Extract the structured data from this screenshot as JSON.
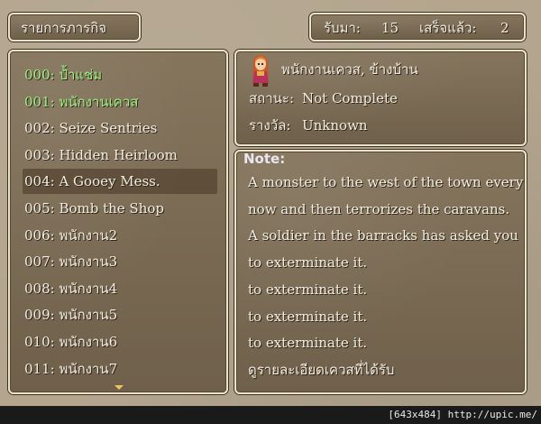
{
  "header": {
    "menu_title": "รายการภารกิจ",
    "received_label": "รับมา:",
    "received_count": "15",
    "completed_label": "เสร็จแล้ว:",
    "completed_count": "2"
  },
  "quest_list": {
    "items": [
      {
        "label": "000: ป้ำแช่ม",
        "completed": true
      },
      {
        "label": "001: พนักงานเควส",
        "completed": true
      },
      {
        "label": "002: Seize Sentries",
        "completed": false
      },
      {
        "label": "003: Hidden Heirloom",
        "completed": false
      },
      {
        "label": "004: A Gooey Mess.",
        "completed": false
      },
      {
        "label": "005: Bomb the Shop",
        "completed": false
      },
      {
        "label": "006: พนักงาน2",
        "completed": false
      },
      {
        "label": "007: พนักงาน3",
        "completed": false
      },
      {
        "label": "008: พนักงาน4",
        "completed": false
      },
      {
        "label": "009: พนักงาน5",
        "completed": false
      },
      {
        "label": "010: พนักงาน6",
        "completed": false
      },
      {
        "label": "011: พนักงาน7",
        "completed": false
      }
    ],
    "selected_index": 4
  },
  "quest_info": {
    "client": "พนักงานเควส, ข้างบ้าน",
    "status_label": "สถานะ:",
    "status_value": "Not Complete",
    "reward_label": "รางวัล:",
    "reward_value": "Unknown"
  },
  "note": {
    "title": "Note:",
    "lines": [
      "A monster to the west of the town every",
      "now and then terrorizes the caravans.",
      "A soldier in the barracks has asked you",
      "to exterminate it.",
      "to exterminate it.",
      "to exterminate it.",
      "to exterminate it.",
      "ดูรายละเอียดเควสที่ได้รับ"
    ]
  },
  "colors": {
    "completed_quest": "#9df285",
    "normal_text": "#f4efe2",
    "note_title": "#eae6f2",
    "scroll_arrow": "#f2c35e"
  },
  "icons": {
    "portrait": "quest-giver-portrait",
    "scroll": "scroll-down-arrow"
  },
  "watermark": "[643x484] http://upic.me/"
}
